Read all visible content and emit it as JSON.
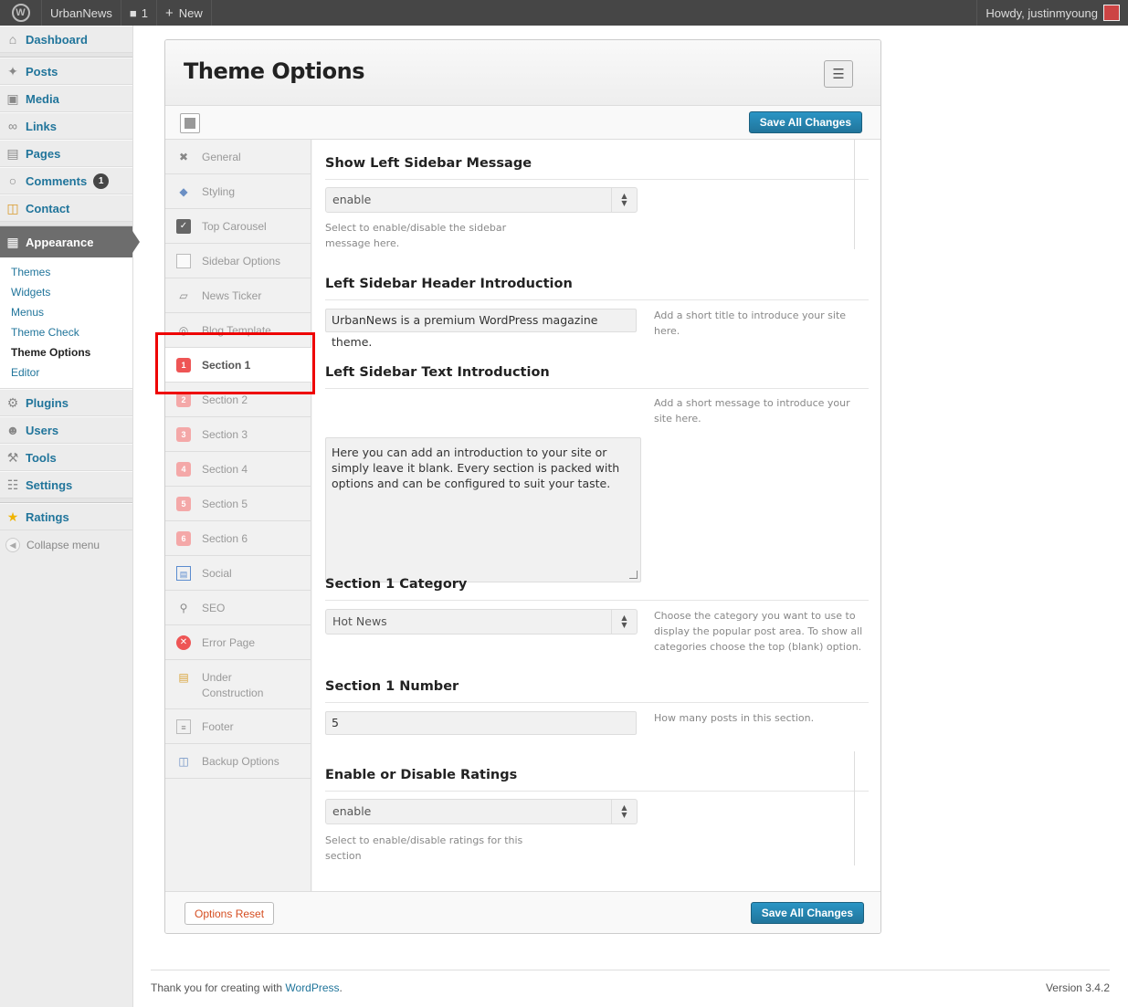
{
  "adminbar": {
    "site_name": "UrbanNews",
    "comments_count": "1",
    "new_label": "New",
    "howdy": "Howdy, justinmyoung"
  },
  "menu": {
    "dashboard": "Dashboard",
    "posts": "Posts",
    "media": "Media",
    "links": "Links",
    "pages": "Pages",
    "comments": "Comments",
    "comments_badge": "1",
    "contact": "Contact",
    "appearance": "Appearance",
    "submenu": [
      "Themes",
      "Widgets",
      "Menus",
      "Theme Check",
      "Theme Options",
      "Editor"
    ],
    "plugins": "Plugins",
    "users": "Users",
    "tools": "Tools",
    "settings": "Settings",
    "ratings": "Ratings",
    "collapse": "Collapse menu"
  },
  "panel": {
    "title": "Theme Options",
    "save_label": "Save All Changes",
    "reset_label": "Options Reset"
  },
  "tabs": [
    {
      "label": "General",
      "icon": "wrench-icon"
    },
    {
      "label": "Styling",
      "icon": "paint-bucket-icon"
    },
    {
      "label": "Top Carousel",
      "icon": "checkbox-icon"
    },
    {
      "label": "Sidebar Options",
      "icon": "sidebar-icon"
    },
    {
      "label": "News Ticker",
      "icon": "ticket-icon"
    },
    {
      "label": "Blog Template",
      "icon": "wordpress-icon"
    },
    {
      "label": "Section 1",
      "icon": "number-badge-icon",
      "badge": "1"
    },
    {
      "label": "Section 2",
      "icon": "number-badge-icon",
      "badge": "2"
    },
    {
      "label": "Section 3",
      "icon": "number-badge-icon",
      "badge": "3"
    },
    {
      "label": "Section 4",
      "icon": "number-badge-icon",
      "badge": "4"
    },
    {
      "label": "Section 5",
      "icon": "number-badge-icon",
      "badge": "5"
    },
    {
      "label": "Section 6",
      "icon": "number-badge-icon",
      "badge": "6"
    },
    {
      "label": "Social",
      "icon": "social-icon"
    },
    {
      "label": "SEO",
      "icon": "magnifier-icon"
    },
    {
      "label": "Error Page",
      "icon": "error-icon"
    },
    {
      "label": "Under Construction",
      "icon": "barrier-icon"
    },
    {
      "label": "Footer",
      "icon": "footer-icon"
    },
    {
      "label": "Backup Options",
      "icon": "backup-icon"
    }
  ],
  "fields": {
    "show_left_sidebar": {
      "title": "Show Left Sidebar Message",
      "value": "enable",
      "desc": "Select to enable/disable the sidebar message here."
    },
    "header_intro": {
      "title": "Left Sidebar Header Introduction",
      "value": "UrbanNews is a premium WordPress magazine theme.",
      "desc": "Add a short title to introduce your site here."
    },
    "text_intro": {
      "title": "Left Sidebar Text Introduction",
      "value": "Here you can add an introduction to your site or simply leave it blank. Every section is packed with options and can be configured to suit your taste.",
      "desc": "Add a short message to introduce your site here."
    },
    "section1_category": {
      "title": "Section 1 Category",
      "value": "Hot News",
      "desc": "Choose the category you want to use to display the popular post area. To show all categories choose the top (blank) option."
    },
    "section1_number": {
      "title": "Section 1 Number",
      "value": "5",
      "desc": "How many posts in this section."
    },
    "ratings": {
      "title": "Enable or Disable Ratings",
      "value": "enable",
      "desc": "Select to enable/disable ratings for this section"
    }
  },
  "footer": {
    "thanks": "Thank you for creating with ",
    "link": "WordPress",
    "period": ".",
    "version": "Version 3.4.2"
  }
}
